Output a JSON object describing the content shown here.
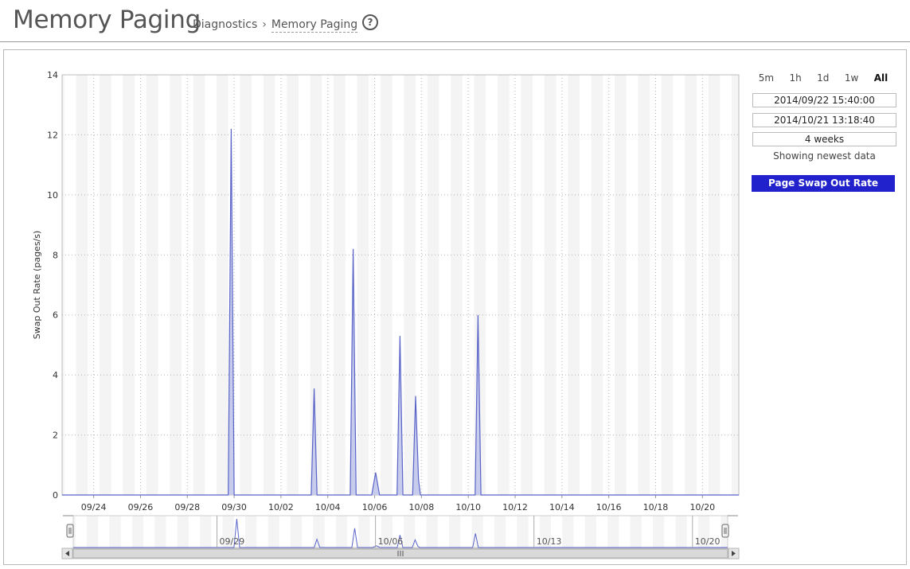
{
  "header": {
    "title": "Memory Paging",
    "breadcrumb": {
      "parent": "Diagnostics",
      "separator": "›",
      "current": "Memory Paging"
    },
    "help_glyph": "?"
  },
  "controls": {
    "ranges": [
      "5m",
      "1h",
      "1d",
      "1w",
      "All"
    ],
    "active_range": "All",
    "start": "2014/09/22 15:40:00",
    "end": "2014/10/21 13:18:40",
    "duration": "4 weeks",
    "status": "Showing newest data",
    "legend_label": "Page Swap Out Rate"
  },
  "colors": {
    "series_line": "#5a64c8",
    "series_fill": "#c8ccec",
    "legend_bg": "#2222cc",
    "band": "#f4f4f4"
  },
  "chart_data": {
    "type": "area",
    "ylabel": "Swap Out Rate (pages/s)",
    "ylim": [
      0,
      14
    ],
    "yticks": [
      0,
      2,
      4,
      6,
      8,
      10,
      12,
      14
    ],
    "xlim": [
      "2014-09-22T15:40",
      "2014-10-21T13:18"
    ],
    "xticks": [
      {
        "date": "2014-09-24",
        "label": "09/24"
      },
      {
        "date": "2014-09-26",
        "label": "09/26"
      },
      {
        "date": "2014-09-28",
        "label": "09/28"
      },
      {
        "date": "2014-09-30",
        "label": "09/30"
      },
      {
        "date": "2014-10-02",
        "label": "10/02"
      },
      {
        "date": "2014-10-04",
        "label": "10/04"
      },
      {
        "date": "2014-10-06",
        "label": "10/06"
      },
      {
        "date": "2014-10-08",
        "label": "10/08"
      },
      {
        "date": "2014-10-10",
        "label": "10/10"
      },
      {
        "date": "2014-10-12",
        "label": "10/12"
      },
      {
        "date": "2014-10-14",
        "label": "10/14"
      },
      {
        "date": "2014-10-16",
        "label": "10/16"
      },
      {
        "date": "2014-10-18",
        "label": "10/18"
      },
      {
        "date": "2014-10-20",
        "label": "10/20"
      }
    ],
    "navigator_ticks": [
      {
        "date": "2014-09-29",
        "label": "09/29"
      },
      {
        "date": "2014-10-06",
        "label": "10/06"
      },
      {
        "date": "2014-10-13",
        "label": "10/13"
      },
      {
        "date": "2014-10-20",
        "label": "10/20"
      }
    ],
    "grid": true,
    "legend": "right",
    "series": [
      {
        "name": "Page Swap Out Rate",
        "points": [
          {
            "x": "2014-09-22T15:40",
            "y": 0
          },
          {
            "x": "2014-09-29T18:00",
            "y": 0
          },
          {
            "x": "2014-09-29T21:00",
            "y": 12.2
          },
          {
            "x": "2014-09-30T00:00",
            "y": 0
          },
          {
            "x": "2014-10-03T07:00",
            "y": 0
          },
          {
            "x": "2014-10-03T10:00",
            "y": 3.55
          },
          {
            "x": "2014-10-03T13:00",
            "y": 0
          },
          {
            "x": "2014-10-04T23:00",
            "y": 0
          },
          {
            "x": "2014-10-05T02:00",
            "y": 8.2
          },
          {
            "x": "2014-10-05T05:00",
            "y": 0
          },
          {
            "x": "2014-10-05T21:00",
            "y": 0
          },
          {
            "x": "2014-10-06T01:00",
            "y": 0.75
          },
          {
            "x": "2014-10-06T05:00",
            "y": 0
          },
          {
            "x": "2014-10-06T23:00",
            "y": 0
          },
          {
            "x": "2014-10-07T02:00",
            "y": 5.3
          },
          {
            "x": "2014-10-07T05:00",
            "y": 0
          },
          {
            "x": "2014-10-07T15:00",
            "y": 0
          },
          {
            "x": "2014-10-07T18:00",
            "y": 3.3
          },
          {
            "x": "2014-10-07T21:00",
            "y": 0.5
          },
          {
            "x": "2014-10-07T23:00",
            "y": 0
          },
          {
            "x": "2014-10-10T07:00",
            "y": 0
          },
          {
            "x": "2014-10-10T10:00",
            "y": 6.0
          },
          {
            "x": "2014-10-10T13:00",
            "y": 0
          },
          {
            "x": "2014-10-21T13:18",
            "y": 0
          }
        ]
      }
    ]
  }
}
